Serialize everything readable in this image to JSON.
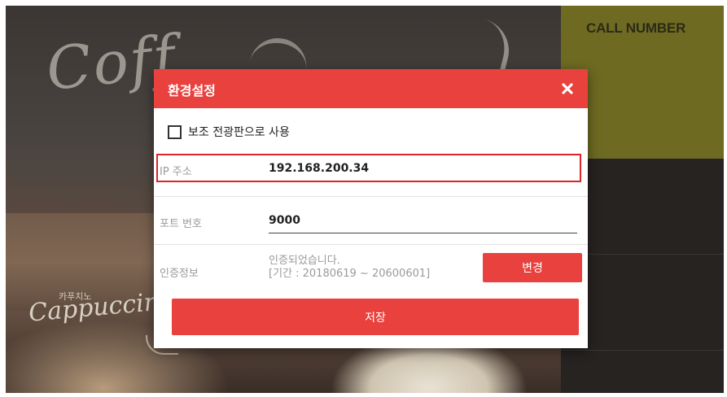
{
  "background": {
    "script_top": "Coff",
    "script_bottom": "Cappuccino",
    "script_bottom_korean": "카푸치노"
  },
  "right_panel": {
    "header_title": "CALL NUMBER"
  },
  "modal": {
    "title": "환경설정",
    "close_glyph": "✖",
    "secondary_display_checkbox": {
      "label": "보조 전광판으로 사용",
      "checked": false
    },
    "ip": {
      "label": "IP 주소",
      "value": "192.168.200.34"
    },
    "port": {
      "label": "포트 번호",
      "value": "9000"
    },
    "auth": {
      "label": "인증정보",
      "status_line1": "인증되었습니다.",
      "status_line2": "[기간 : 20180619 ~ 20600601]",
      "change_button": "변경"
    },
    "save_button": "저장"
  },
  "colors": {
    "accent_red": "#e8413e",
    "highlight_border": "#d9252c",
    "call_header": "#6e6a22"
  }
}
